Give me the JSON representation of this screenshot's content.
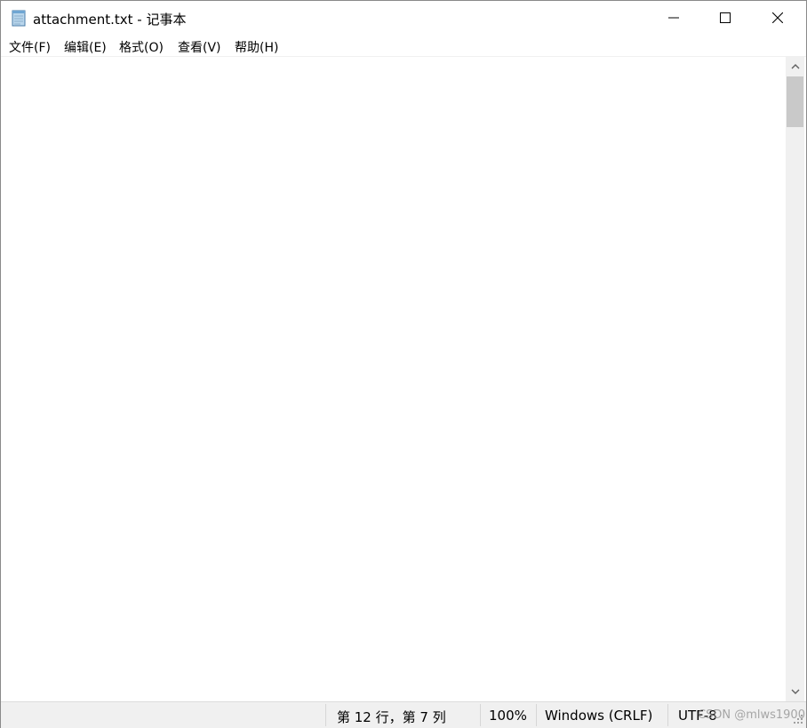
{
  "window": {
    "title": "attachment.txt - 记事本",
    "minimize_icon": "minimize-icon",
    "maximize_icon": "maximize-icon",
    "close_icon": "close-icon",
    "app_icon": "notepad-icon"
  },
  "menu": {
    "items": [
      {
        "label": "文件(F)"
      },
      {
        "label": "编辑(E)"
      },
      {
        "label": "格式(O)"
      },
      {
        "label": "查看(V)"
      },
      {
        "label": "帮助(H)"
      }
    ]
  },
  "editor": {
    "content": ""
  },
  "status": {
    "position": "第 12 行，第 7 列",
    "zoom": "100%",
    "line_ending": "Windows (CRLF)",
    "encoding": "UTF-8"
  },
  "watermark": "CSDN @mlws1900"
}
